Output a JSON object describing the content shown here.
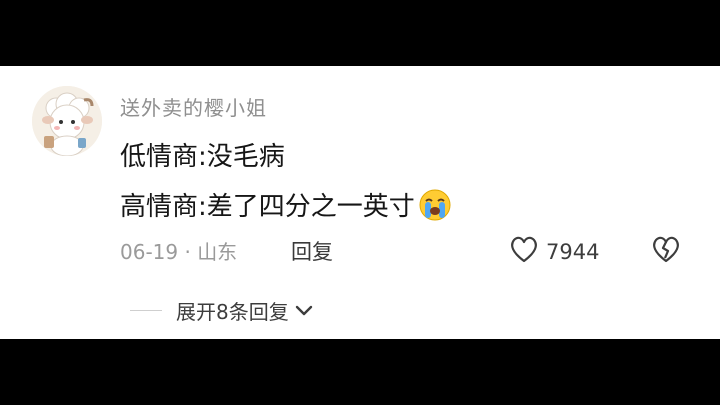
{
  "comment": {
    "username": "送外卖的樱小姐",
    "lines": [
      "低情商:没毛病",
      "高情商:差了四分之一英寸"
    ],
    "emoji": "crying-face-emoji",
    "meta": "06-19 · 山东",
    "reply_label": "回复",
    "like_count": "7944"
  },
  "replies": {
    "expand_label": "展开8条回复"
  },
  "colors": {
    "background": "#000000",
    "card": "#ffffff",
    "text": "#161616",
    "muted": "#9a9a9a",
    "username": "#8f8f8f"
  }
}
